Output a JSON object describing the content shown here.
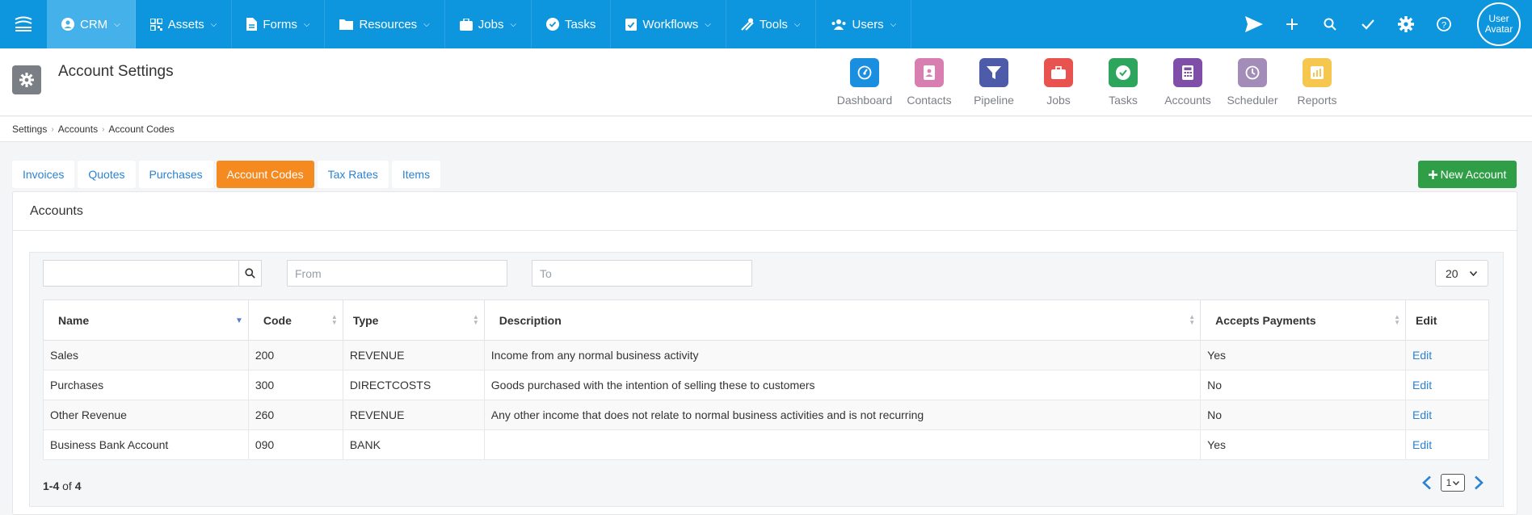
{
  "nav": {
    "items": [
      {
        "label": "CRM",
        "icon": "user-circle-icon",
        "active": true
      },
      {
        "label": "Assets",
        "icon": "qr-code-icon",
        "active": false
      },
      {
        "label": "Forms",
        "icon": "file-icon",
        "active": false
      },
      {
        "label": "Resources",
        "icon": "folder-icon",
        "active": false
      },
      {
        "label": "Jobs",
        "icon": "briefcase-icon",
        "active": false
      },
      {
        "label": "Tasks",
        "icon": "check-circle-icon",
        "active": false
      },
      {
        "label": "Workflows",
        "icon": "clipboard-check-icon",
        "active": false
      },
      {
        "label": "Tools",
        "icon": "tools-icon",
        "active": false
      },
      {
        "label": "Users",
        "icon": "users-icon",
        "active": false
      }
    ],
    "avatar_alt": "User Avatar"
  },
  "header": {
    "title": "Account Settings",
    "apps": [
      {
        "label": "Dashboard",
        "color": "#1a8fe0",
        "icon": "gauge-icon"
      },
      {
        "label": "Contacts",
        "color": "#d97eb0",
        "icon": "address-book-icon"
      },
      {
        "label": "Pipeline",
        "color": "#4d5ba8",
        "icon": "filter-icon"
      },
      {
        "label": "Jobs",
        "color": "#e8524f",
        "icon": "briefcase-icon"
      },
      {
        "label": "Tasks",
        "color": "#2da55c",
        "icon": "check-circle-icon"
      },
      {
        "label": "Accounts",
        "color": "#7e4ea8",
        "icon": "calculator-icon"
      },
      {
        "label": "Scheduler",
        "color": "#a38db8",
        "icon": "clock-icon"
      },
      {
        "label": "Reports",
        "color": "#f5c74e",
        "icon": "chart-icon"
      }
    ]
  },
  "breadcrumb": [
    "Settings",
    "Accounts",
    "Account Codes"
  ],
  "tabs": [
    {
      "label": "Invoices",
      "active": false
    },
    {
      "label": "Quotes",
      "active": false
    },
    {
      "label": "Purchases",
      "active": false
    },
    {
      "label": "Account Codes",
      "active": true
    },
    {
      "label": "Tax Rates",
      "active": false
    },
    {
      "label": "Items",
      "active": false
    }
  ],
  "new_account_label": "New Account",
  "panel": {
    "title": "Accounts",
    "from_placeholder": "From",
    "to_placeholder": "To",
    "page_size": "20",
    "columns": [
      "Name",
      "Code",
      "Type",
      "Description",
      "Accepts Payments",
      "Edit"
    ],
    "rows": [
      {
        "name": "Sales",
        "code": "200",
        "type": "REVENUE",
        "description": "Income from any normal business activity",
        "accepts": "Yes",
        "edit": "Edit"
      },
      {
        "name": "Purchases",
        "code": "300",
        "type": "DIRECTCOSTS",
        "description": "Goods purchased with the intention of selling these to customers",
        "accepts": "No",
        "edit": "Edit"
      },
      {
        "name": "Other Revenue",
        "code": "260",
        "type": "REVENUE",
        "description": "Any other income that does not relate to normal business activities and is not recurring",
        "accepts": "No",
        "edit": "Edit"
      },
      {
        "name": "Business Bank Account",
        "code": "090",
        "type": "BANK",
        "description": "",
        "accepts": "Yes",
        "edit": "Edit"
      }
    ],
    "count": {
      "range": "1-4",
      "of": "of",
      "total": "4"
    },
    "current_page": "1"
  }
}
